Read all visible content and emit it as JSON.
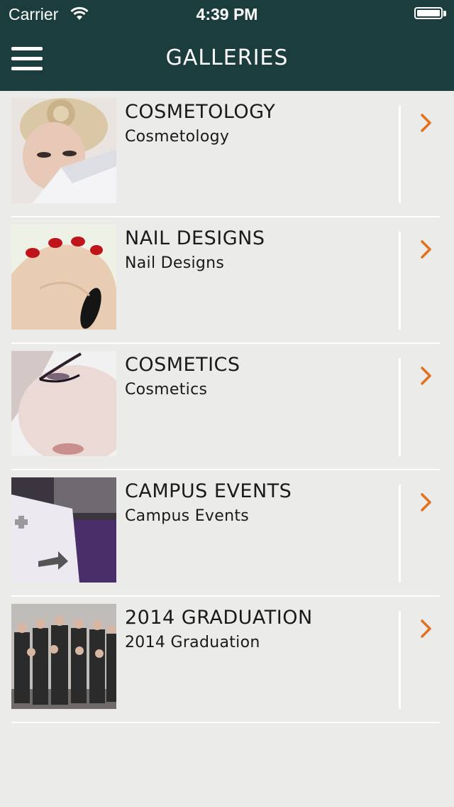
{
  "status_bar": {
    "carrier": "Carrier",
    "time": "4:39 PM",
    "wifi_icon": "wifi-icon",
    "battery_icon": "battery-icon"
  },
  "nav": {
    "title": "GALLERIES",
    "menu_icon": "hamburger-menu-icon"
  },
  "colors": {
    "nav_bg": "#1b3d3e",
    "background": "#ebebea",
    "chevron": "#e2711d",
    "separator": "#ffffff"
  },
  "galleries": [
    {
      "title": "COSMETOLOGY",
      "subtitle": "Cosmetology"
    },
    {
      "title": "NAIL DESIGNS",
      "subtitle": "Nail Designs"
    },
    {
      "title": "COSMETICS",
      "subtitle": "Cosmetics"
    },
    {
      "title": "CAMPUS EVENTS",
      "subtitle": "Campus Events"
    },
    {
      "title": "2014 GRADUATION",
      "subtitle": "2014 Graduation"
    }
  ]
}
